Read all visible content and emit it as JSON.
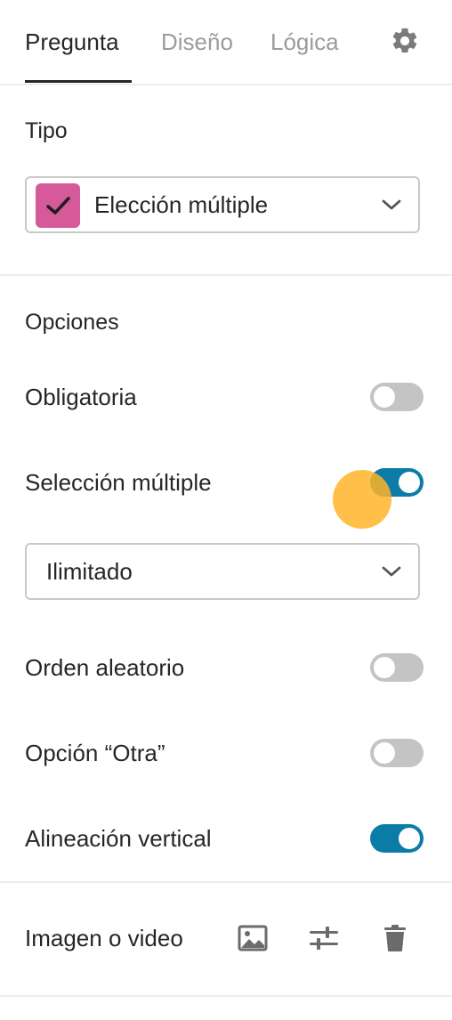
{
  "tabs": [
    {
      "label": "Pregunta",
      "active": true
    },
    {
      "label": "Diseño",
      "active": false
    },
    {
      "label": "Lógica",
      "active": false
    }
  ],
  "tipo": {
    "title": "Tipo",
    "selected": "Elección múltiple",
    "badge_color": "#d65a9a"
  },
  "opciones": {
    "title": "Opciones",
    "obligatoria": {
      "label": "Obligatoria",
      "on": false
    },
    "seleccion_multiple": {
      "label": "Selección múltiple",
      "on": true
    },
    "limit": {
      "selected": "Ilimitado"
    },
    "orden_aleatorio": {
      "label": "Orden aleatorio",
      "on": false
    },
    "opcion_otra": {
      "label": "Opción “Otra”",
      "on": false
    },
    "alineacion_vertical": {
      "label": "Alineación vertical",
      "on": true
    }
  },
  "media": {
    "title": "Imagen o video"
  },
  "colors": {
    "toggle_on": "#0a7ca6",
    "toggle_off": "#c4c4c4",
    "accent_badge": "#d65a9a",
    "cursor_marker": "#ffb428"
  }
}
